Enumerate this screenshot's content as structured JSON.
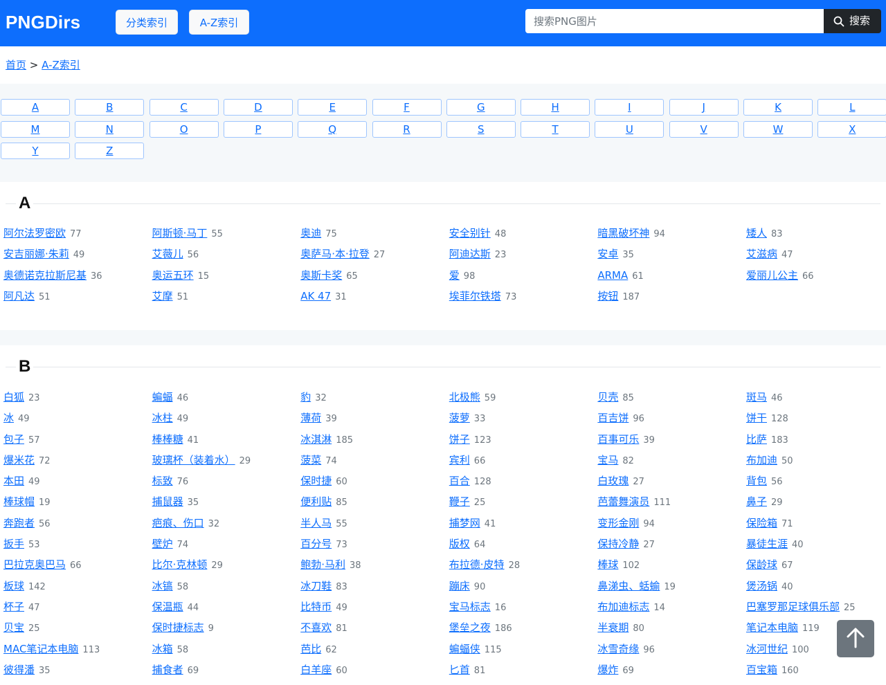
{
  "header": {
    "logo": "PNGDirs",
    "nav": [
      "分类索引",
      "A-Z索引"
    ],
    "search_placeholder": "搜索PNG图片",
    "search_button": "搜索",
    "search_icon": "search-icon"
  },
  "breadcrumb": {
    "home": "首页",
    "separator": ">",
    "current": "A-Z索引"
  },
  "letters": [
    "A",
    "B",
    "C",
    "D",
    "E",
    "F",
    "G",
    "H",
    "I",
    "J",
    "K",
    "L",
    "M",
    "N",
    "O",
    "P",
    "Q",
    "R",
    "S",
    "T",
    "U",
    "V",
    "W",
    "X",
    "Y",
    "Z"
  ],
  "sections": [
    {
      "letter": "A",
      "items": [
        {
          "name": "阿尔法罗密欧",
          "count": "77"
        },
        {
          "name": "阿斯顿·马丁",
          "count": "55"
        },
        {
          "name": "奥迪",
          "count": "75"
        },
        {
          "name": "安全别针",
          "count": "48"
        },
        {
          "name": "暗黑破坏神",
          "count": "94"
        },
        {
          "name": "矮人",
          "count": "83"
        },
        {
          "name": "安吉丽娜·朱莉",
          "count": "49"
        },
        {
          "name": "艾薇儿",
          "count": "56"
        },
        {
          "name": "奥萨马·本·拉登",
          "count": "27"
        },
        {
          "name": "阿迪达斯",
          "count": "23"
        },
        {
          "name": "安卓",
          "count": "35"
        },
        {
          "name": "艾滋病",
          "count": "47"
        },
        {
          "name": "奥德诺克拉斯尼基",
          "count": "36"
        },
        {
          "name": "奥运五环",
          "count": "15"
        },
        {
          "name": "奥斯卡奖",
          "count": "65"
        },
        {
          "name": "爱",
          "count": "98"
        },
        {
          "name": "ARMA",
          "count": "61"
        },
        {
          "name": "爱丽儿公主",
          "count": "66"
        },
        {
          "name": "阿凡达",
          "count": "51"
        },
        {
          "name": "艾摩",
          "count": "51"
        },
        {
          "name": "AK 47",
          "count": "31"
        },
        {
          "name": "埃菲尔铁塔",
          "count": "73"
        },
        {
          "name": "按钮",
          "count": "187"
        }
      ]
    },
    {
      "letter": "B",
      "items": [
        {
          "name": "白狐",
          "count": "23"
        },
        {
          "name": "蝙蝠",
          "count": "46"
        },
        {
          "name": "豹",
          "count": "32"
        },
        {
          "name": "北极熊",
          "count": "59"
        },
        {
          "name": "贝壳",
          "count": "85"
        },
        {
          "name": "斑马",
          "count": "46"
        },
        {
          "name": "冰",
          "count": "49"
        },
        {
          "name": "冰柱",
          "count": "49"
        },
        {
          "name": "薄荷",
          "count": "39"
        },
        {
          "name": "菠萝",
          "count": "33"
        },
        {
          "name": "百吉饼",
          "count": "96"
        },
        {
          "name": "饼干",
          "count": "128"
        },
        {
          "name": "包子",
          "count": "57"
        },
        {
          "name": "棒棒糖",
          "count": "41"
        },
        {
          "name": "冰淇淋",
          "count": "185"
        },
        {
          "name": "饼子",
          "count": "123"
        },
        {
          "name": "百事可乐",
          "count": "39"
        },
        {
          "name": "比萨",
          "count": "183"
        },
        {
          "name": "爆米花",
          "count": "72"
        },
        {
          "name": "玻璃杯（装着水）",
          "count": "29"
        },
        {
          "name": "菠菜",
          "count": "74"
        },
        {
          "name": "宾利",
          "count": "66"
        },
        {
          "name": "宝马",
          "count": "82"
        },
        {
          "name": "布加迪",
          "count": "50"
        },
        {
          "name": "本田",
          "count": "49"
        },
        {
          "name": "标致",
          "count": "76"
        },
        {
          "name": "保时捷",
          "count": "60"
        },
        {
          "name": "百合",
          "count": "128"
        },
        {
          "name": "白玫瑰",
          "count": "27"
        },
        {
          "name": "背包",
          "count": "56"
        },
        {
          "name": "棒球帽",
          "count": "19"
        },
        {
          "name": "捕鼠器",
          "count": "35"
        },
        {
          "name": "便利贴",
          "count": "85"
        },
        {
          "name": "鞭子",
          "count": "25"
        },
        {
          "name": "芭蕾舞演员",
          "count": "111"
        },
        {
          "name": "鼻子",
          "count": "29"
        },
        {
          "name": "奔跑者",
          "count": "56"
        },
        {
          "name": "疤痕、伤口",
          "count": "32"
        },
        {
          "name": "半人马",
          "count": "55"
        },
        {
          "name": "捕梦网",
          "count": "41"
        },
        {
          "name": "变形金刚",
          "count": "94"
        },
        {
          "name": "保险箱",
          "count": "71"
        },
        {
          "name": "扳手",
          "count": "53"
        },
        {
          "name": "壁炉",
          "count": "74"
        },
        {
          "name": "百分号",
          "count": "73"
        },
        {
          "name": "版权",
          "count": "64"
        },
        {
          "name": "保持冷静",
          "count": "27"
        },
        {
          "name": "暴徒生涯",
          "count": "40"
        },
        {
          "name": "巴拉克奥巴马",
          "count": "66"
        },
        {
          "name": "比尔·克林顿",
          "count": "29"
        },
        {
          "name": "鲍勃·马利",
          "count": "38"
        },
        {
          "name": "布拉德·皮特",
          "count": "28"
        },
        {
          "name": "棒球",
          "count": "102"
        },
        {
          "name": "保龄球",
          "count": "67"
        },
        {
          "name": "板球",
          "count": "142"
        },
        {
          "name": "冰镐",
          "count": "58"
        },
        {
          "name": "冰刀鞋",
          "count": "83"
        },
        {
          "name": "蹦床",
          "count": "90"
        },
        {
          "name": "鼻涕虫、蛞蝓",
          "count": "19"
        },
        {
          "name": "煲汤锅",
          "count": "40"
        },
        {
          "name": "杯子",
          "count": "47"
        },
        {
          "name": "保温瓶",
          "count": "44"
        },
        {
          "name": "比特币",
          "count": "49"
        },
        {
          "name": "宝马标志",
          "count": "16"
        },
        {
          "name": "布加迪标志",
          "count": "14"
        },
        {
          "name": "巴塞罗那足球俱乐部",
          "count": "25"
        },
        {
          "name": "贝宝",
          "count": "25"
        },
        {
          "name": "保时捷标志",
          "count": "9"
        },
        {
          "name": "不喜欢",
          "count": "81"
        },
        {
          "name": "堡垒之夜",
          "count": "186"
        },
        {
          "name": "半衰期",
          "count": "80"
        },
        {
          "name": "笔记本电脑",
          "count": "119"
        },
        {
          "name": "MAC笔记本电脑",
          "count": "113"
        },
        {
          "name": "冰箱",
          "count": "58"
        },
        {
          "name": "芭比",
          "count": "62"
        },
        {
          "name": "蝙蝠侠",
          "count": "115"
        },
        {
          "name": "冰雪奇缘",
          "count": "96"
        },
        {
          "name": "冰河世纪",
          "count": "100"
        },
        {
          "name": "彼得潘",
          "count": "35"
        },
        {
          "name": "捕食者",
          "count": "69"
        },
        {
          "name": "白羊座",
          "count": "60"
        },
        {
          "name": "匕首",
          "count": "81"
        },
        {
          "name": "爆炸",
          "count": "69"
        },
        {
          "name": "百宝箱",
          "count": "160"
        }
      ]
    }
  ],
  "back_to_top_icon": "arrow-up-icon"
}
